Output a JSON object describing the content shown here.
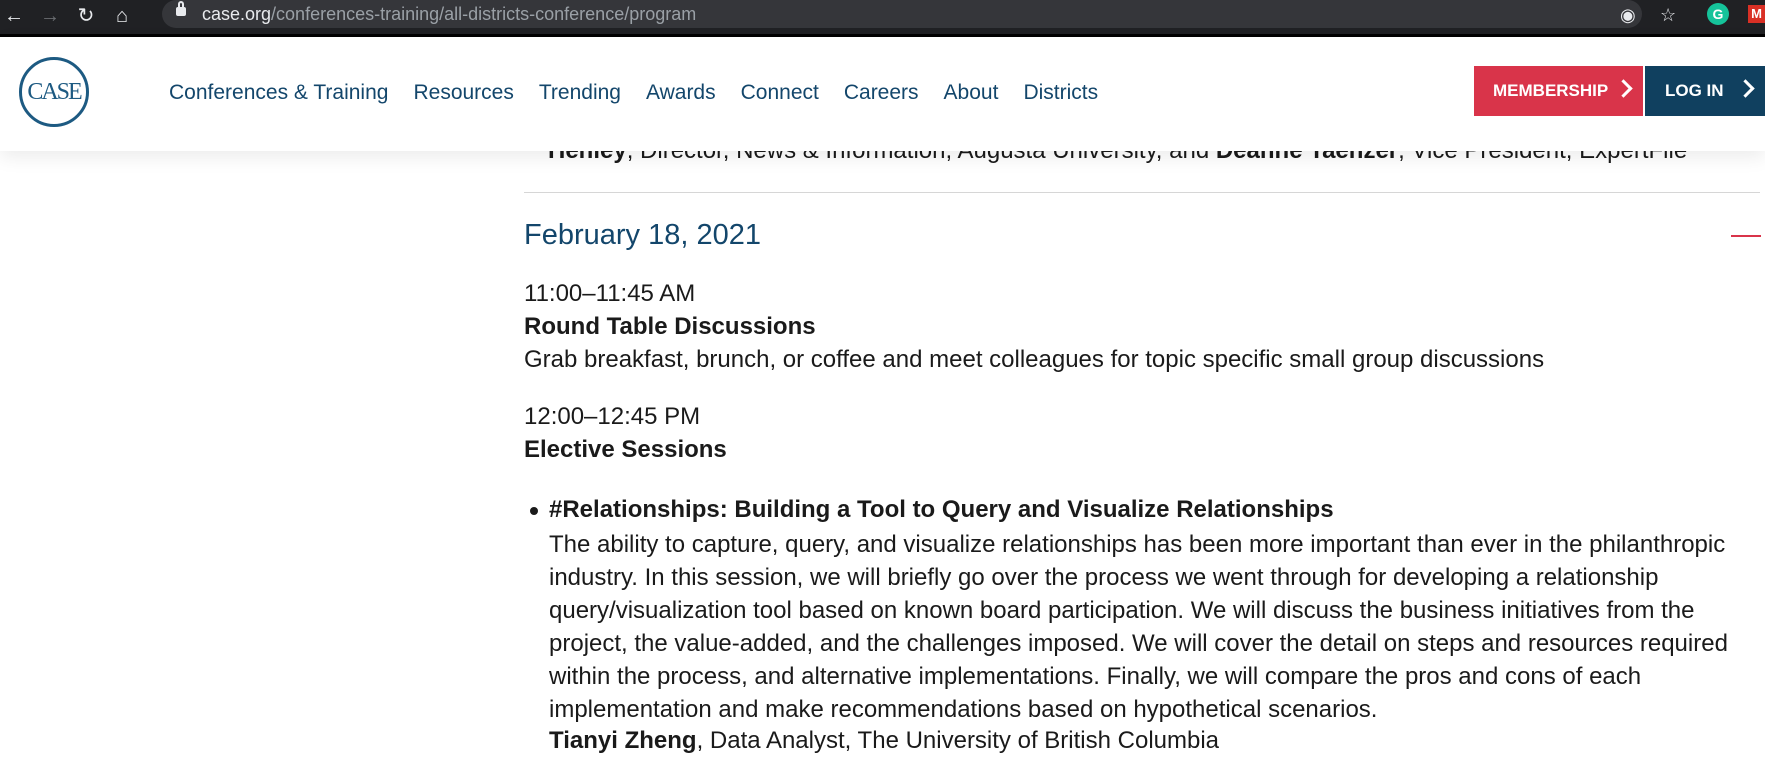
{
  "browser": {
    "url_host": "case.org",
    "url_path": "/conferences-training/all-districts-conference/program"
  },
  "brand": {
    "logo_text": "CASE"
  },
  "nav": {
    "items": [
      "Conferences & Training",
      "Resources",
      "Trending",
      "Awards",
      "Connect",
      "Careers",
      "About",
      "Districts"
    ],
    "membership_label": "MEMBERSHIP",
    "login_label": "LOG IN"
  },
  "prev_item": {
    "name_end": "Henley",
    "middle": ", Director, News & Information, Augusta University, and ",
    "name2": "Deanne Taenzer",
    "tail": ", Vice President, ExpertFile"
  },
  "day": {
    "date": "February 18, 2021",
    "sessions": [
      {
        "time": "11:00–11:45 AM",
        "title": "Round Table Discussions",
        "description": "Grab breakfast, brunch, or coffee and meet colleagues for topic specific small group discussions"
      },
      {
        "time": "12:00–12:45 PM",
        "title": "Elective Sessions",
        "items": [
          {
            "title": "#Relationships: Building a Tool to Query and Visualize Relationships",
            "body": "The ability to capture, query, and visualize relationships has been more important than ever in the philanthropic industry. In this session, we will briefly go over the process we went through for developing a relationship query/visualization tool based on known board participation. We will discuss the business initiatives from the project, the value-added, and the challenges imposed. We will cover the detail on steps and resources required within the process, and alternative implementations. Finally, we will compare the pros and cons of each implementation and make recommendations based on hypothetical scenarios.",
            "speaker_name": "Tianyi Zheng",
            "speaker_role": ", Data Analyst, The University of British Columbia"
          }
        ]
      }
    ]
  },
  "colors": {
    "brand_blue": "#13466b",
    "accent_red": "#d9344a",
    "login_bg": "#10405f"
  }
}
